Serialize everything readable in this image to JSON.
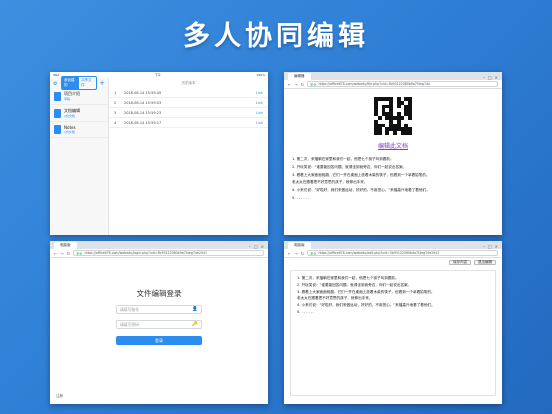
{
  "hero_title": "多人协同编辑",
  "ipad": {
    "status_left": "iPad",
    "status_center": "下午",
    "status_right": "100%",
    "seg_left": "我创建的",
    "seg_right": "共享文件",
    "plus": "+",
    "list_header": "历史版本",
    "folders": [
      {
        "name": "项目介绍",
        "sub": "草稿"
      },
      {
        "name": "文档编辑",
        "sub": "2份文档"
      },
      {
        "name": "Notes",
        "sub": "1份文档"
      }
    ],
    "versions": [
      {
        "num": "1",
        "time": "2018-08-14 15:59:45",
        "act": "Link"
      },
      {
        "num": "2",
        "time": "2018-08-14 15:59:03",
        "act": "Link"
      },
      {
        "num": "3",
        "time": "2018-08-14 15:59:23",
        "act": "Link"
      },
      {
        "num": "4",
        "time": "2018-08-14 15:59:17",
        "act": "Link"
      }
    ]
  },
  "doc_view": {
    "tab": "编辑器",
    "secure": "安全",
    "url": "https://office678.com/webedu/file.php?uid=3b93122080b9a7f4eg74a",
    "edit_link": "编辑此文档",
    "lines": [
      "1. 第二次，来福躺在家里和我们一起，他把七个孩子叫到跟前。",
      "2. 开玩笑说：“谁要能回答问题，就请坐到我旁边，你们一起说出答案。",
      "3. 看着上大家面面相觑，它们一齐在桌面上放着木柴的筷子，但看到一个拿着铅笔的。",
      "   老太太在跟着把不好意思的孩子，就伸出手来。",
      "4. 小来们说：“好啦好，我们来做运动，好好的，不用担心。”来福高兴地看了看他们。",
      "5. . . . . . ."
    ]
  },
  "login": {
    "tab": "电脑版",
    "secure": "安全",
    "url": "https://office678.com/webedu/login.php?uid=3b93122080b9a7f4eg74e2941",
    "title": "文件编辑登录",
    "username_placeholder": "请填写账号",
    "password_placeholder": "请填写密码",
    "submit": "登录",
    "footer": "注册"
  },
  "editor": {
    "tab": "电脑版",
    "secure": "安全",
    "url": "https://office678.com/webedu/edit.php?uid=3b93122080b9a7f4eg74e2941",
    "btn_save": "保存内容",
    "btn_exit": "退出编辑",
    "lines": [
      "1. 第二次，来福躺在家里和我们一起，他把七个孩子叫到跟前。",
      "2. 开玩笑说：“谁要能回答问题，就请坐到我旁边，你们一起说出答案。",
      "3. 看着上大家面面相觑，它们一齐在桌面上放着木柴的筷子，但看到一个拿着铅笔的。",
      "   老太太在跟着把不好意思的孩子，就伸出手来。",
      "4. 小来们说：“好啦好，我们来做运动，好好的，不用担心。”来福高兴地看了看他们。",
      "5. . . . . . ."
    ]
  }
}
